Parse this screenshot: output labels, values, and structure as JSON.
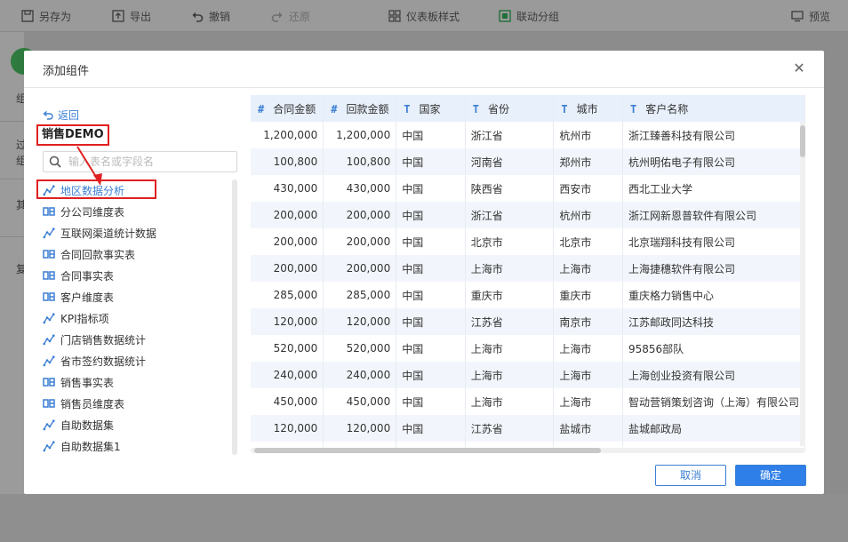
{
  "toolbar": {
    "save_as": "另存为",
    "export": "导出",
    "undo": "撤销",
    "redo": "还原",
    "dashboard_style": "仪表板样式",
    "linkage_group": "联动分组",
    "preview": "预览"
  },
  "background": {
    "left_glyphs": [
      "组",
      "过",
      "组",
      "其",
      "复"
    ]
  },
  "modal": {
    "title": "添加组件",
    "back": "返回",
    "package_name": "销售DEMO",
    "search_placeholder": "输入表名或字段名",
    "tables": [
      {
        "label": "地区数据分析",
        "icon": "self-service-dataset-icon",
        "selected": true
      },
      {
        "label": "分公司维度表",
        "icon": "database-table-icon"
      },
      {
        "label": "互联网渠道统计数据",
        "icon": "self-service-dataset-icon"
      },
      {
        "label": "合同回款事实表",
        "icon": "database-table-icon"
      },
      {
        "label": "合同事实表",
        "icon": "database-table-icon"
      },
      {
        "label": "客户维度表",
        "icon": "database-table-icon"
      },
      {
        "label": "KPI指标项",
        "icon": "self-service-dataset-icon"
      },
      {
        "label": "门店销售数据统计",
        "icon": "self-service-dataset-icon"
      },
      {
        "label": "省市签约数据统计",
        "icon": "self-service-dataset-icon"
      },
      {
        "label": "销售事实表",
        "icon": "database-table-icon"
      },
      {
        "label": "销售员维度表",
        "icon": "database-table-icon"
      },
      {
        "label": "自助数据集",
        "icon": "self-service-dataset-icon"
      },
      {
        "label": "自助数据集1",
        "icon": "self-service-dataset-icon"
      }
    ],
    "columns": [
      {
        "type": "#",
        "name": "合同金额",
        "align": "num"
      },
      {
        "type": "#",
        "name": "回款金额",
        "align": "num"
      },
      {
        "type": "T",
        "name": "国家",
        "align": "text"
      },
      {
        "type": "T",
        "name": "省份",
        "align": "text"
      },
      {
        "type": "T",
        "name": "城市",
        "align": "text"
      },
      {
        "type": "T",
        "name": "客户名称",
        "align": "text"
      }
    ],
    "rows": [
      [
        "1,200,000",
        "1,200,000",
        "中国",
        "浙江省",
        "杭州市",
        "浙江臻善科技有限公司"
      ],
      [
        "100,800",
        "100,800",
        "中国",
        "河南省",
        "郑州市",
        "杭州明佑电子有限公司"
      ],
      [
        "430,000",
        "430,000",
        "中国",
        "陕西省",
        "西安市",
        "西北工业大学"
      ],
      [
        "200,000",
        "200,000",
        "中国",
        "浙江省",
        "杭州市",
        "浙江网新恩普软件有限公司"
      ],
      [
        "200,000",
        "200,000",
        "中国",
        "北京市",
        "北京市",
        "北京瑞翔科技有限公司"
      ],
      [
        "200,000",
        "200,000",
        "中国",
        "上海市",
        "上海市",
        "上海捷穗软件有限公司"
      ],
      [
        "285,000",
        "285,000",
        "中国",
        "重庆市",
        "重庆市",
        "重庆格力销售中心"
      ],
      [
        "120,000",
        "120,000",
        "中国",
        "江苏省",
        "南京市",
        "江苏邮政同达科技"
      ],
      [
        "520,000",
        "520,000",
        "中国",
        "上海市",
        "上海市",
        "95856部队"
      ],
      [
        "240,000",
        "240,000",
        "中国",
        "上海市",
        "上海市",
        "上海创业投资有限公司"
      ],
      [
        "450,000",
        "450,000",
        "中国",
        "上海市",
        "上海市",
        "智动营销策划咨询（上海）有限公司"
      ],
      [
        "120,000",
        "120,000",
        "中国",
        "江苏省",
        "盐城市",
        "盐城邮政局"
      ],
      [
        "",
        "",
        "",
        "",
        "",
        ""
      ]
    ],
    "cancel": "取消",
    "confirm": "确定"
  },
  "colors": {
    "accent": "#2f7fe8",
    "highlight_box": "#e02020",
    "header_bg": "#e8f0fb",
    "stripe_bg": "#f2f6fc"
  }
}
